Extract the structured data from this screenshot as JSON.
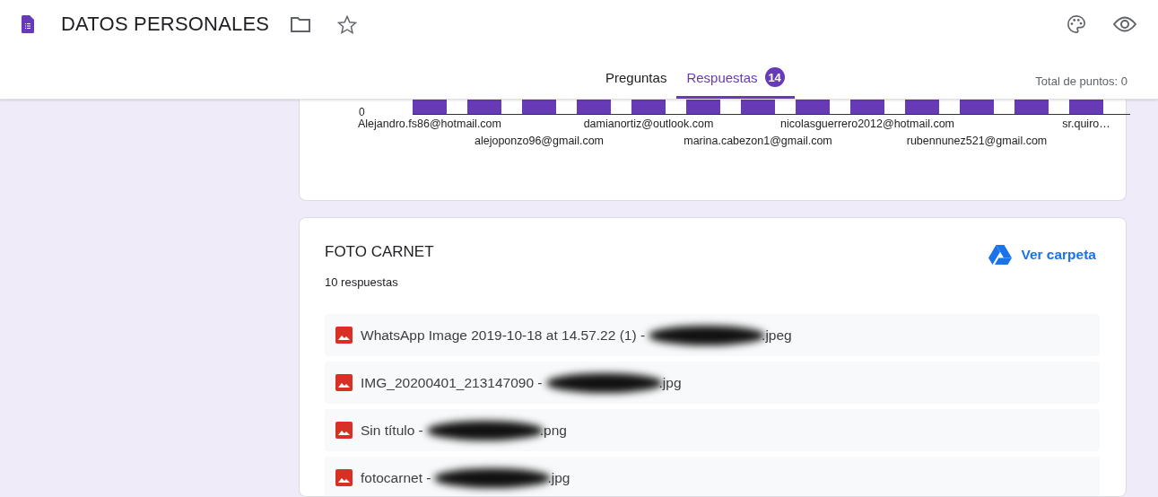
{
  "header": {
    "title": "DATOS PERSONALES",
    "tabs": [
      {
        "label": "Preguntas",
        "selected": false
      },
      {
        "label": "Respuestas",
        "selected": true,
        "badge": "14"
      }
    ],
    "total_points": "Total de puntos: 0"
  },
  "chart_card": {
    "y_tick": "0",
    "x_labels": [
      "Alejandro.fs86@hotmail.com",
      "alejoponzo96@gmail.com",
      "damianortiz@outlook.com",
      "marina.cabezon1@gmail.com",
      "nicolasguerrero2012@hotmail.com",
      "rubennunez521@gmail.com",
      "sr.quiro…"
    ]
  },
  "files_card": {
    "title": "FOTO CARNET",
    "count": "10 respuestas",
    "folder_link": "Ver carpeta",
    "files": [
      {
        "name_start": "WhatsApp Image 2019-10-18 at 14.57.22 (1) -",
        "name_end": ".jpeg"
      },
      {
        "name_start": "IMG_20200401_213147090 -",
        "name_end": ".jpg"
      },
      {
        "name_start": "Sin título -",
        "name_end": ".png"
      },
      {
        "name_start": "fotocarnet -",
        "name_end": ".jpg"
      }
    ]
  }
}
